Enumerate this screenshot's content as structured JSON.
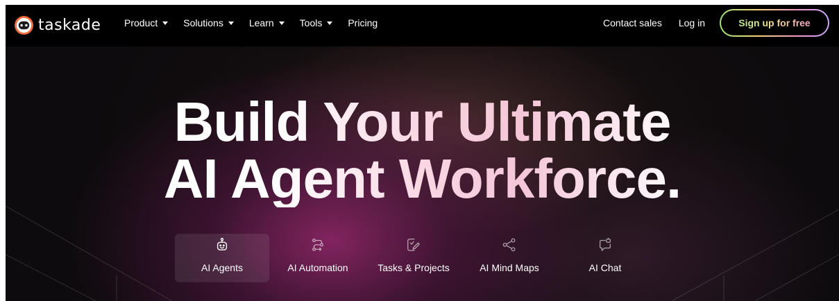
{
  "brand": {
    "name": "taskade"
  },
  "nav": {
    "menu": [
      {
        "label": "Product",
        "has_dropdown": true
      },
      {
        "label": "Solutions",
        "has_dropdown": true
      },
      {
        "label": "Learn",
        "has_dropdown": true
      },
      {
        "label": "Tools",
        "has_dropdown": true
      },
      {
        "label": "Pricing",
        "has_dropdown": false
      }
    ],
    "contact_label": "Contact sales",
    "login_label": "Log in",
    "signup_label": "Sign up for free"
  },
  "hero": {
    "headline_line1": "Build Your Ultimate",
    "headline_line2": "AI Agent Workforce.",
    "tabs": [
      {
        "label": "AI Agents",
        "icon": "robot-icon",
        "active": true
      },
      {
        "label": "AI Automation",
        "icon": "automation-flow-icon",
        "active": false
      },
      {
        "label": "Tasks & Projects",
        "icon": "task-edit-icon",
        "active": false
      },
      {
        "label": "AI Mind Maps",
        "icon": "share-nodes-icon",
        "active": false
      },
      {
        "label": "AI Chat",
        "icon": "chat-bubble-icon",
        "active": false
      }
    ]
  },
  "colors": {
    "nav_bg": "#000000",
    "hero_bg": "#0d0b0d",
    "accent_magenta": "#962a6e",
    "signup_gradient": [
      "#9be37a",
      "#f4d27a",
      "#f39ac0",
      "#c9a5ff"
    ]
  }
}
